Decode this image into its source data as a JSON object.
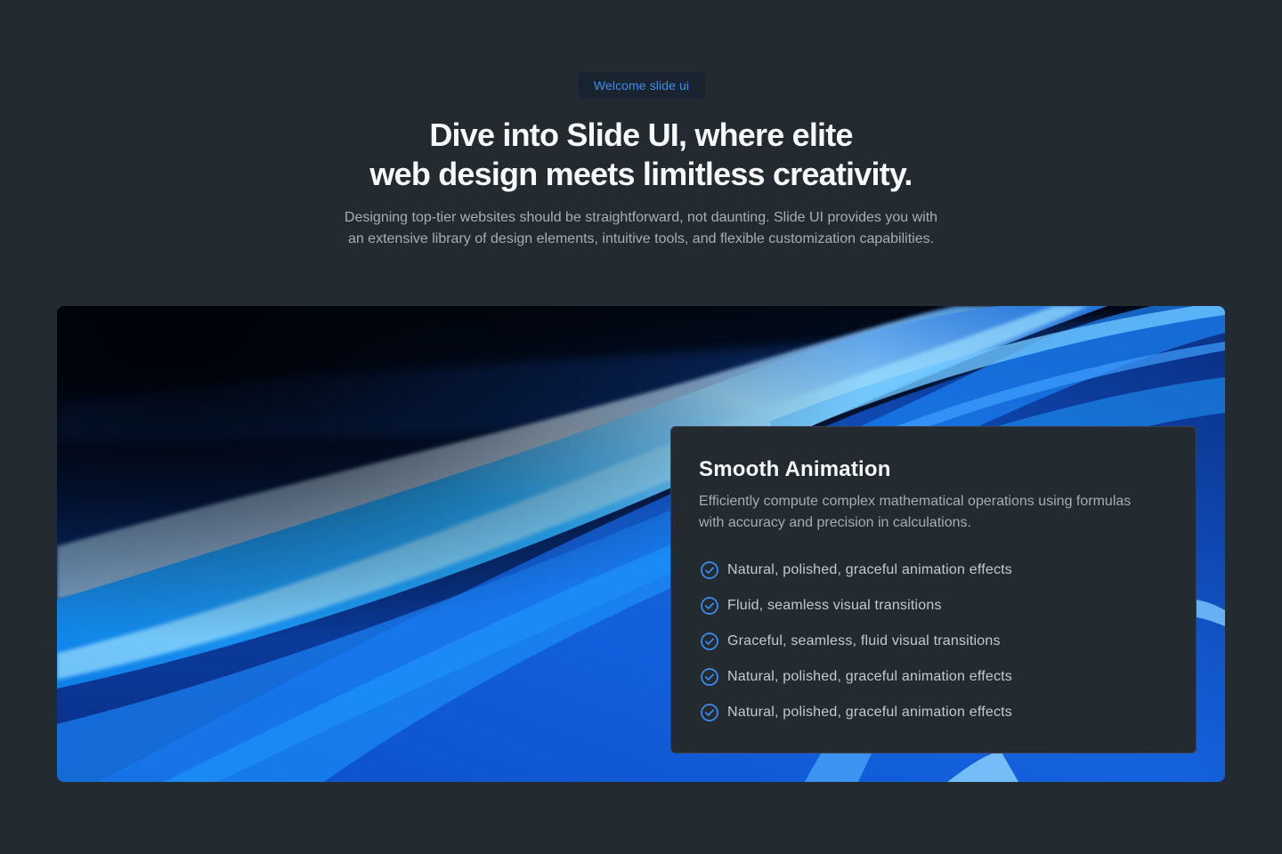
{
  "badge": {
    "label": "Welcome slide ui"
  },
  "hero": {
    "title_line1": "Dive into Slide UI, where elite",
    "title_line2": "web design meets limitless creativity.",
    "description_line1": "Designing top-tier websites should be straightforward, not daunting. Slide UI provides you with",
    "description_line2": "an extensive library of design elements, intuitive tools, and flexible customization capabilities."
  },
  "feature_card": {
    "title": "Smooth Animation",
    "description_line1": "Efficiently compute complex mathematical operations using formulas",
    "description_line2": "with accuracy and precision in calculations.",
    "items": [
      {
        "label": "Natural, polished, graceful animation effects",
        "icon": "check-circle-icon"
      },
      {
        "label": "Fluid, seamless visual transitions",
        "icon": "check-circle-icon"
      },
      {
        "label": "Graceful, seamless, fluid visual transitions",
        "icon": "check-circle-icon"
      },
      {
        "label": "Natural, polished, graceful animation effects",
        "icon": "check-circle-icon"
      },
      {
        "label": "Natural, polished, graceful animation effects",
        "icon": "check-circle-icon"
      }
    ]
  },
  "colors": {
    "background": "#232a30",
    "accent": "#3b8ef0",
    "card_background": "#232a30",
    "card_border": "#3a434c"
  }
}
